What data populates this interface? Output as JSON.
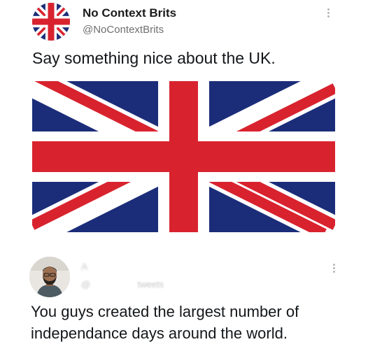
{
  "post": {
    "author": {
      "display_name": "No Context Brits",
      "handle": "@NoContextBrits",
      "avatar_icon": "union-jack-flag-icon"
    },
    "text": "Say something nice about the UK.",
    "image": {
      "subject": "union-jack-flag-icon",
      "colors": {
        "blue": "#1b2d79",
        "red": "#d8232f",
        "white": "#ffffff"
      }
    },
    "more_icon": "more-vertical-icon"
  },
  "reply": {
    "author": {
      "display_name": "A",
      "handle": "@",
      "handle_suffix": "tweets",
      "avatar_icon": "user-avatar-icon"
    },
    "text": "You guys created the largest number of independance days around the world.",
    "more_icon": "more-vertical-icon"
  }
}
